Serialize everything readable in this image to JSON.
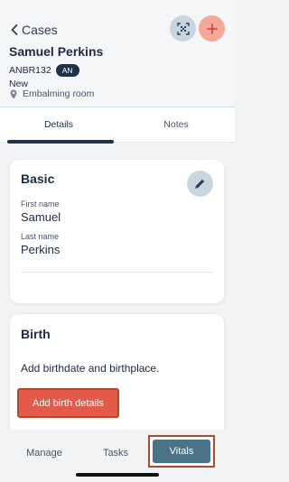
{
  "header": {
    "back_label": "Cases",
    "patient_name": "Samuel Perkins",
    "case_id": "ANBR132",
    "badge": "AN",
    "status": "New",
    "location": "Embalming room"
  },
  "tabs": [
    {
      "label": "Details",
      "active": true
    },
    {
      "label": "Notes",
      "active": false
    }
  ],
  "basic": {
    "title": "Basic",
    "first_name_label": "First name",
    "first_name": "Samuel",
    "last_name_label": "Last name",
    "last_name": "Perkins"
  },
  "birth": {
    "title": "Birth",
    "description": "Add birthdate and birthplace.",
    "button_label": "Add birth details"
  },
  "bottom_nav": [
    {
      "label": "Manage",
      "active": false
    },
    {
      "label": "Tasks",
      "active": false
    },
    {
      "label": "Vitals",
      "active": true
    }
  ],
  "colors": {
    "primary_dark": "#1f3146",
    "accent_red": "#e45a4a",
    "add_button": "#f5a79a",
    "vitals_active": "#4a7388",
    "highlight_border": "#b24a2a"
  },
  "icons": [
    "chevron-left-icon",
    "qr-code-icon",
    "plus-icon",
    "location-pin-icon",
    "pencil-icon"
  ]
}
